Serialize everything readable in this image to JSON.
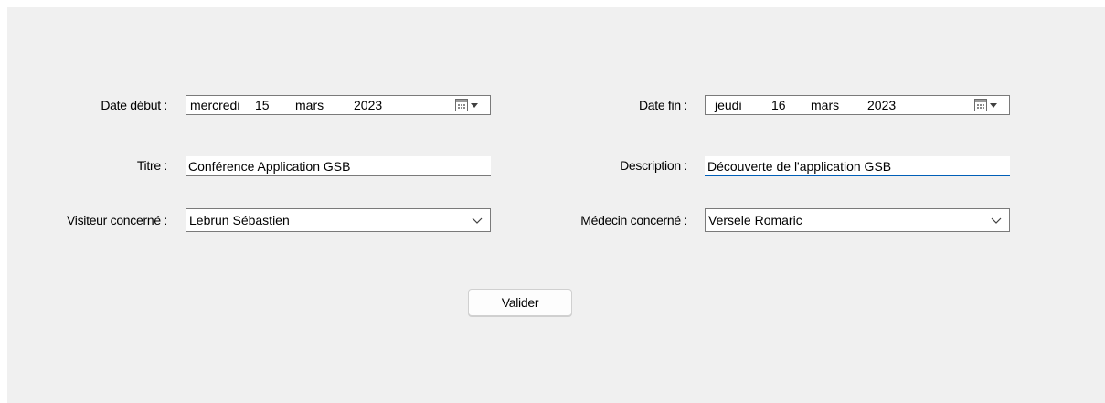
{
  "form": {
    "date_debut": {
      "label": "Date début :",
      "weekday": "mercredi",
      "day": "15",
      "month": "mars",
      "year": "2023"
    },
    "date_fin": {
      "label": "Date fin :",
      "weekday": "jeudi",
      "day": "16",
      "month": "mars",
      "year": "2023"
    },
    "titre": {
      "label": "Titre :",
      "value": "Conférence Application GSB"
    },
    "description": {
      "label": "Description :",
      "value": "Découverte de l'application GSB"
    },
    "visiteur": {
      "label": "Visiteur concerné :",
      "selected": "Lebrun Sébastien"
    },
    "medecin": {
      "label": "Médecin concerné :",
      "selected": "Versele Romaric"
    },
    "submit_label": "Valider"
  },
  "colors": {
    "background": "#f0f0f0",
    "field_border": "#7a7a7a",
    "focus_accent": "#005fb8"
  },
  "icons": {
    "date_picker": "calendar-dropdown-icon",
    "combo": "chevron-down-icon"
  }
}
